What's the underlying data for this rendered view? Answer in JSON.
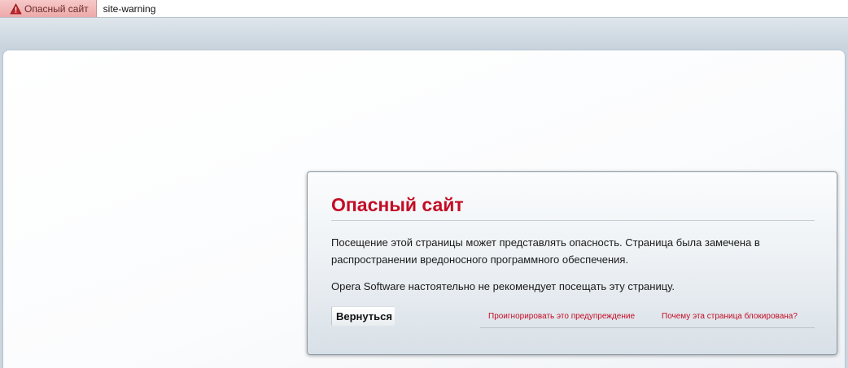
{
  "address_bar": {
    "security_badge_label": "Опасный сайт",
    "security_badge_icon": "warning-triangle-icon",
    "url": "site-warning"
  },
  "dialog": {
    "title": "Опасный сайт",
    "paragraph_1": "Посещение этой страницы может представлять опасность. Страница была замечена в распространении вредоносного программного обеспечения.",
    "paragraph_2": "Opera Software настоятельно не рекомендует посещать эту страницу.",
    "back_button_label": "Вернуться",
    "ignore_link": "Проигнорировать это предупреждение",
    "why_link": "Почему эта страница блокирована?"
  },
  "colors": {
    "accent_red": "#c40c25",
    "badge_bg": "#eda9a9"
  }
}
